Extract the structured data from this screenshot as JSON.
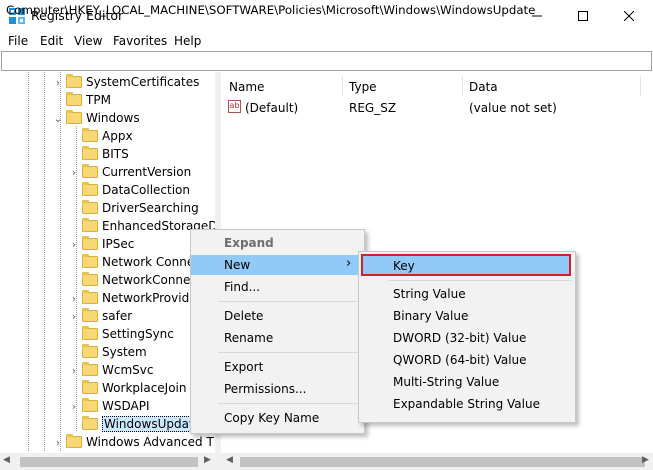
{
  "window": {
    "title": "Registry Editor",
    "icon": "registry-editor-icon",
    "minimize": "—",
    "maximize": "☐",
    "close": "✕"
  },
  "menu": [
    "File",
    "Edit",
    "View",
    "Favorites",
    "Help"
  ],
  "address": "Computer\\HKEY_LOCAL_MACHINE\\SOFTWARE\\Policies\\Microsoft\\Windows\\WindowsUpdate",
  "tree": {
    "items": [
      {
        "label": "SystemCertificates",
        "expander": "›"
      },
      {
        "label": "TPM",
        "expander": ""
      },
      {
        "label": "Windows",
        "expander": "⌄"
      },
      {
        "label": "Appx",
        "expander": ""
      },
      {
        "label": "BITS",
        "expander": ""
      },
      {
        "label": "CurrentVersion",
        "expander": "›"
      },
      {
        "label": "DataCollection",
        "expander": ""
      },
      {
        "label": "DriverSearching",
        "expander": ""
      },
      {
        "label": "EnhancedStorageD",
        "expander": ""
      },
      {
        "label": "IPSec",
        "expander": "›"
      },
      {
        "label": "Network Connec",
        "expander": ""
      },
      {
        "label": "NetworkConnect",
        "expander": ""
      },
      {
        "label": "NetworkProvider",
        "expander": "›"
      },
      {
        "label": "safer",
        "expander": "›"
      },
      {
        "label": "SettingSync",
        "expander": ""
      },
      {
        "label": "System",
        "expander": ""
      },
      {
        "label": "WcmSvc",
        "expander": "›"
      },
      {
        "label": "WorkplaceJoin",
        "expander": ""
      },
      {
        "label": "WSDAPI",
        "expander": "›"
      },
      {
        "label": "WindowsUpdate",
        "expander": ""
      },
      {
        "label": "Windows Advanced T",
        "expander": "›"
      }
    ]
  },
  "list": {
    "columns": [
      "Name",
      "Type",
      "Data"
    ],
    "rows": [
      {
        "name": "(Default)",
        "type": "REG_SZ",
        "data": "(value not set)",
        "icon": "ab"
      }
    ]
  },
  "context_menu": {
    "items": [
      "Expand",
      "New",
      "Find...",
      "Delete",
      "Rename",
      "Export",
      "Permissions...",
      "Copy Key Name"
    ],
    "submenu_arrow": "›"
  },
  "submenu": {
    "items": [
      "Key",
      "String Value",
      "Binary Value",
      "DWORD (32-bit) Value",
      "QWORD (64-bit) Value",
      "Multi-String Value",
      "Expandable String Value"
    ]
  },
  "colors": {
    "highlight": "#91c9f7",
    "key_outline": "#d0202a",
    "folder": "#f8d775"
  }
}
